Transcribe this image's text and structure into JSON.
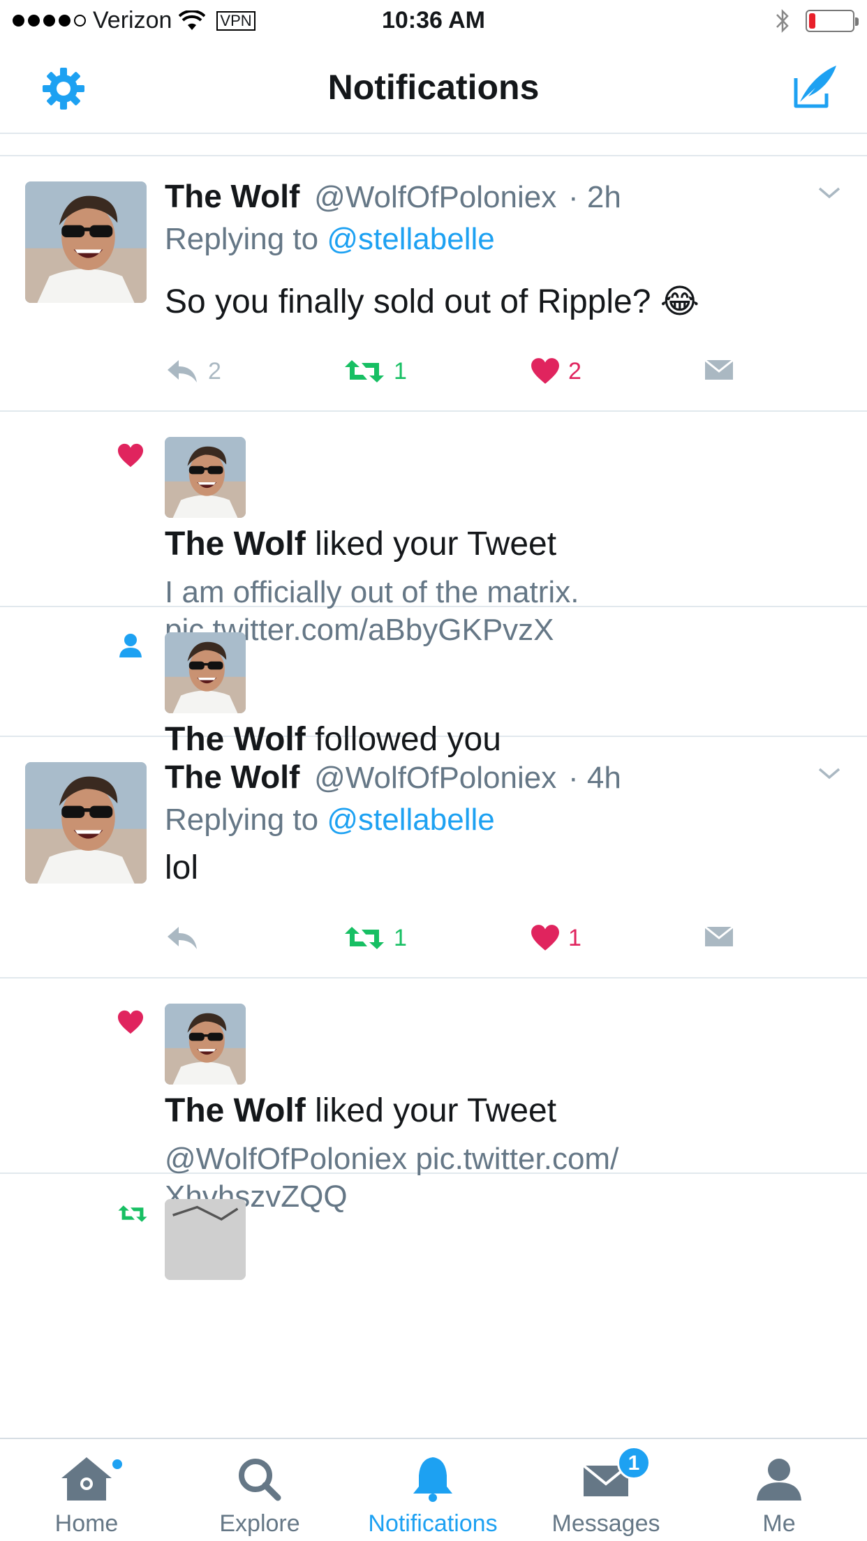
{
  "status_bar": {
    "carrier": "Verizon",
    "vpn": "VPN",
    "time": "10:36 AM",
    "battery_level": 0.15
  },
  "nav": {
    "title": "Notifications",
    "settings_icon": "gear-icon",
    "compose_icon": "compose-icon"
  },
  "feed": {
    "tweet1": {
      "name": "The Wolf",
      "handle": "@WolfOfPoloniex",
      "time": "· 2h",
      "replying_label": "Replying to",
      "replying_to": "@stellabelle",
      "text": "So you finally sold out of Ripple? 😂",
      "replies": "2",
      "retweets": "1",
      "likes": "2"
    },
    "notif1": {
      "type": "like",
      "name": "The Wolf",
      "action": "liked your Tweet",
      "line1": "I am officially out of the matrix.",
      "line2": "pic.twitter.com/aBbyGKPvzX"
    },
    "notif2": {
      "type": "follow",
      "name": "The Wolf",
      "action": "followed you"
    },
    "tweet2": {
      "name": "The Wolf",
      "handle": "@WolfOfPoloniex",
      "time": "· 4h",
      "replying_label": "Replying to",
      "replying_to": "@stellabelle",
      "text": "lol",
      "replies": "",
      "retweets": "1",
      "likes": "1"
    },
    "notif3": {
      "type": "like",
      "name": "The Wolf",
      "action": "liked your Tweet",
      "line1": "@WolfOfPoloniex pic.twitter.com/",
      "line2": "XhvhszvZQQ"
    }
  },
  "tabbar": {
    "home": "Home",
    "explore": "Explore",
    "notifications": "Notifications",
    "messages": "Messages",
    "messages_badge": "1",
    "me": "Me"
  },
  "colors": {
    "accent": "#1da1f2",
    "retweet": "#17bf63",
    "like": "#e0245e",
    "muted": "#657786"
  }
}
